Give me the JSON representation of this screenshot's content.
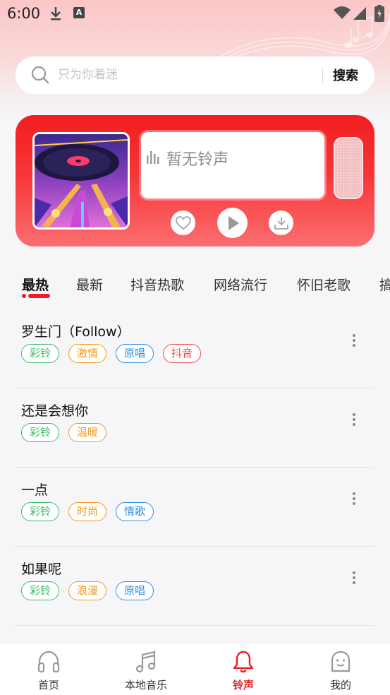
{
  "status_bar": {
    "time": "6:00"
  },
  "search": {
    "placeholder": "只为你着迷",
    "button_label": "搜索"
  },
  "player": {
    "now_playing_text": "暂无铃声"
  },
  "tabs": [
    {
      "label": "最热",
      "active": true
    },
    {
      "label": "最新"
    },
    {
      "label": "抖音热歌"
    },
    {
      "label": "网络流行"
    },
    {
      "label": "怀旧老歌"
    },
    {
      "label": "搞"
    }
  ],
  "songs": [
    {
      "title": "罗生门（Follow）",
      "tags": [
        {
          "label": "彩铃",
          "color": "green"
        },
        {
          "label": "激情",
          "color": "orange"
        },
        {
          "label": "原唱",
          "color": "blue"
        },
        {
          "label": "抖音",
          "color": "red"
        }
      ]
    },
    {
      "title": "还是会想你",
      "tags": [
        {
          "label": "彩铃",
          "color": "green"
        },
        {
          "label": "温暖",
          "color": "orange"
        }
      ]
    },
    {
      "title": "一点",
      "tags": [
        {
          "label": "彩铃",
          "color": "green"
        },
        {
          "label": "时尚",
          "color": "orange"
        },
        {
          "label": "情歌",
          "color": "blue"
        }
      ]
    },
    {
      "title": "如果呢",
      "tags": [
        {
          "label": "彩铃",
          "color": "green"
        },
        {
          "label": "浪漫",
          "color": "orange"
        },
        {
          "label": "原唱",
          "color": "blue"
        }
      ]
    }
  ],
  "bottom_nav": [
    {
      "label": "首页",
      "icon": "headphones-icon"
    },
    {
      "label": "本地音乐",
      "icon": "music-note-icon"
    },
    {
      "label": "铃声",
      "icon": "bell-icon",
      "active": true
    },
    {
      "label": "我的",
      "icon": "profile-face-icon"
    }
  ],
  "colors": {
    "accent": "#ef1c2c",
    "card_red": "#f21e20",
    "tag_green": "#3dbd6a",
    "tag_orange": "#f39a1d",
    "tag_blue": "#2e8ee6",
    "tag_red": "#ef4a4a"
  }
}
